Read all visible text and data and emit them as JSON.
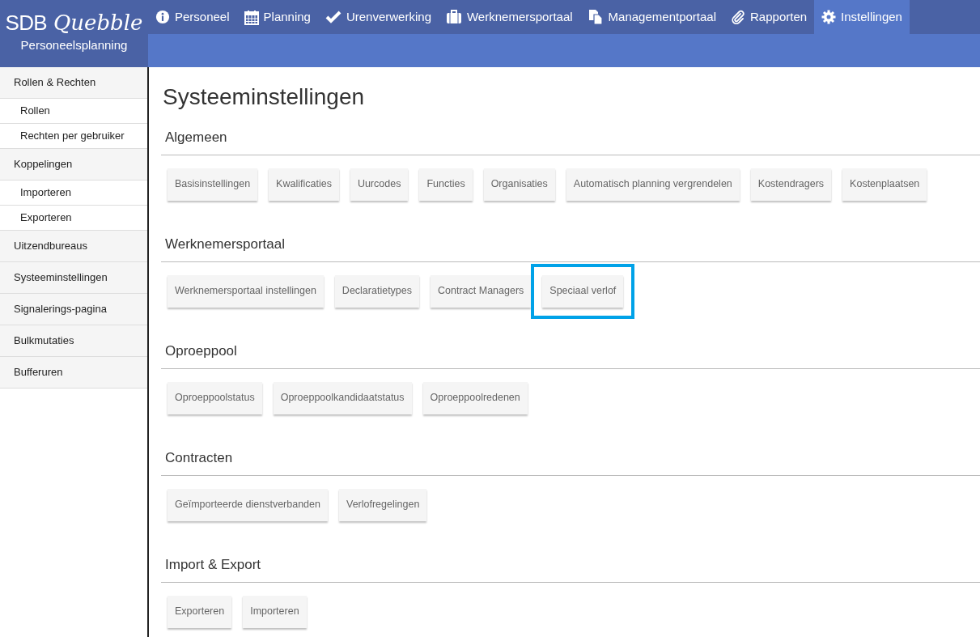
{
  "logo": {
    "brand": "SDB",
    "wordmark": "Quebble",
    "subtitle": "Personeelsplanning"
  },
  "nav": [
    {
      "label": "Personeel",
      "selected": false
    },
    {
      "label": "Planning",
      "selected": false
    },
    {
      "label": "Urenverwerking",
      "selected": false
    },
    {
      "label": "Werknemersportaal",
      "selected": false
    },
    {
      "label": "Managementportaal",
      "selected": false
    },
    {
      "label": "Rapporten",
      "selected": false
    },
    {
      "label": "Instellingen",
      "selected": true
    }
  ],
  "sidebar": {
    "items": [
      {
        "label": "Rollen & Rechten",
        "children": [
          {
            "label": "Rollen"
          },
          {
            "label": "Rechten per gebruiker"
          }
        ]
      },
      {
        "label": "Koppelingen",
        "children": [
          {
            "label": "Importeren"
          },
          {
            "label": "Exporteren"
          }
        ]
      },
      {
        "label": "Uitzendbureaus"
      },
      {
        "label": "Systeeminstellingen"
      },
      {
        "label": "Signalerings-pagina"
      },
      {
        "label": "Bulkmutaties"
      },
      {
        "label": "Bufferuren"
      }
    ]
  },
  "page_title": "Systeeminstellingen",
  "sections": [
    {
      "title": "Algemeen",
      "buttons": [
        {
          "label": "Basisinstellingen",
          "highlighted": false
        },
        {
          "label": "Kwalificaties",
          "highlighted": false
        },
        {
          "label": "Uurcodes",
          "highlighted": false
        },
        {
          "label": "Functies",
          "highlighted": false
        },
        {
          "label": "Organisaties",
          "highlighted": false
        },
        {
          "label": "Automatisch planning vergrendelen",
          "highlighted": false
        },
        {
          "label": "Kostendragers",
          "highlighted": false
        },
        {
          "label": "Kostenplaatsen",
          "highlighted": false
        }
      ]
    },
    {
      "title": "Werknemersportaal",
      "buttons": [
        {
          "label": "Werknemersportaal instellingen",
          "highlighted": false
        },
        {
          "label": "Declaratietypes",
          "highlighted": false
        },
        {
          "label": "Contract Managers",
          "highlighted": false
        },
        {
          "label": "Speciaal verlof",
          "highlighted": true
        }
      ]
    },
    {
      "title": "Oproeppool",
      "buttons": [
        {
          "label": "Oproeppoolstatus",
          "highlighted": false
        },
        {
          "label": "Oproeppoolkandidaatstatus",
          "highlighted": false
        },
        {
          "label": "Oproeppoolredenen",
          "highlighted": false
        }
      ]
    },
    {
      "title": "Contracten",
      "buttons": [
        {
          "label": "Geïmporteerde dienstverbanden",
          "highlighted": false
        },
        {
          "label": "Verlofregelingen",
          "highlighted": false
        }
      ]
    },
    {
      "title": "Import & Export",
      "buttons": [
        {
          "label": "Exporteren",
          "highlighted": false
        },
        {
          "label": "Importeren",
          "highlighted": false
        }
      ]
    }
  ]
}
